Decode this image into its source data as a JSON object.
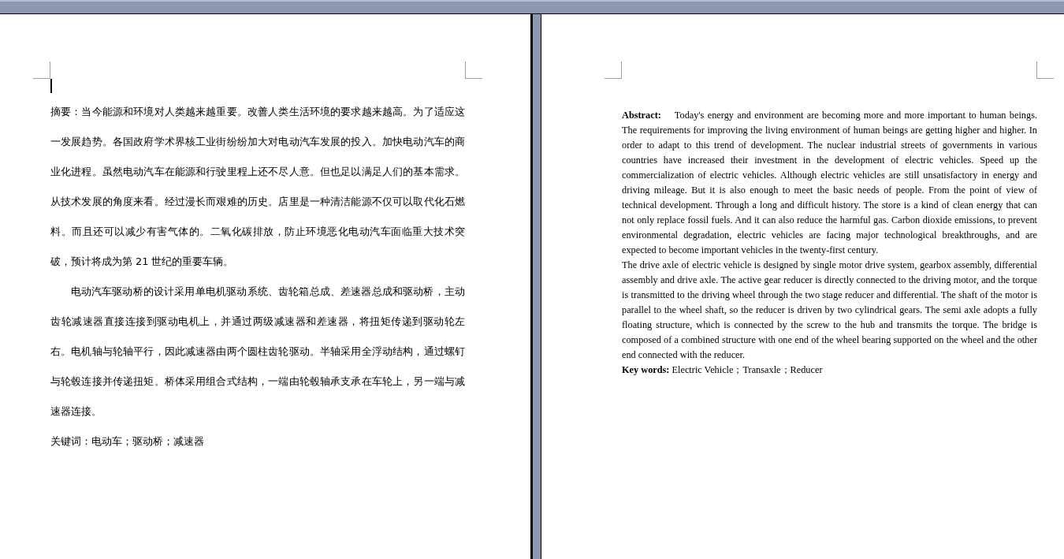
{
  "left_page": {
    "paragraphs": [
      {
        "indent": false,
        "text": "摘要：当今能源和环境对人类越来越重要。改善人类生活环境的要求越来越高。为了适应这一发展趋势。各国政府学术界核工业街纷纷加大对电动汽车发展的投入。加快电动汽车的商业化进程。虽然电动汽车在能源和行驶里程上还不尽人意。但也足以满足人们的基本需求。从技术发展的角度来看。经过漫长而艰难的历史。店里是一种清洁能源不仅可以取代化石燃料。而且还可以减少有害气体的。二氧化碳排放，防止环境恶化电动汽车面临重大技术突破，预计将成为第 21 世纪的重要车辆。"
      },
      {
        "indent": true,
        "text": "电动汽车驱动桥的设计采用单电机驱动系统、齿轮箱总成、差速器总成和驱动桥，主动齿轮减速器直接连接到驱动电机上，并通过两级减速器和差速器，将扭矩传递到驱动轮左右。电机轴与轮轴平行，因此减速器由两个圆柱齿轮驱动。半轴采用全浮动结构，通过螺钉与轮毂连接并传递扭矩。桥体采用组合式结构，一端由轮毂轴承支承在车轮上，另一端与减速器连接。"
      }
    ],
    "keywords": "关键词：电动车；驱动桥；减速器"
  },
  "right_page": {
    "paragraphs": [
      "**Abstract:**    Today's energy and environment are becoming more and more important to human beings. The requirements for improving the living environment of human beings are getting higher and higher. In order to adapt to this trend of development. The nuclear industrial streets of governments in various countries have increased their investment in the development of electric vehicles. Speed up the commercialization of electric vehicles. Although electric vehicles are still unsatisfactory in energy and driving mileage. But it is also enough to meet the basic needs of people. From the point of view of technical development. Through a long and difficult history. The store is a kind of clean energy that can not only replace fossil fuels. And it can also reduce the harmful gas. Carbon dioxide emissions, to prevent environmental degradation, electric vehicles are facing major technological breakthroughs, and are expected to become important vehicles in the twenty-first century.",
      "The drive axle of electric vehicle is designed by single motor drive system, gearbox assembly, differential assembly and drive axle. The active gear reducer is directly connected to the driving motor, and the torque is transmitted to the driving wheel through the two stage reducer and differential. The shaft of the motor is parallel to the wheel shaft, so the reducer is driven by two cylindrical gears. The semi axle adopts a fully floating structure, which is connected by the screw to the hub and transmits the torque. The bridge is composed of a combined structure with one end of the wheel bearing supported on the wheel and the other end connected with the reducer."
    ],
    "keywords": "**Key words:** Electric Vehicle；Transaxle；Reducer"
  }
}
